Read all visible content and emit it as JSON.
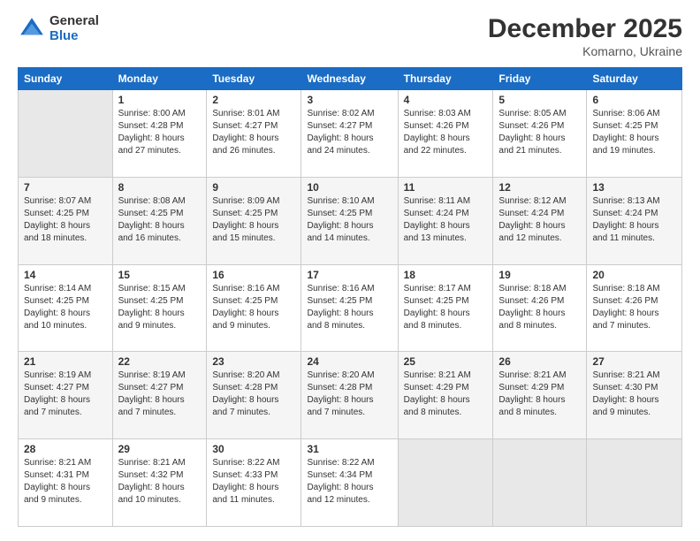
{
  "logo": {
    "general": "General",
    "blue": "Blue"
  },
  "header": {
    "title": "December 2025",
    "location": "Komarno, Ukraine"
  },
  "days_of_week": [
    "Sunday",
    "Monday",
    "Tuesday",
    "Wednesday",
    "Thursday",
    "Friday",
    "Saturday"
  ],
  "weeks": [
    [
      {
        "day": "",
        "info": ""
      },
      {
        "day": "1",
        "info": "Sunrise: 8:00 AM\nSunset: 4:28 PM\nDaylight: 8 hours\nand 27 minutes."
      },
      {
        "day": "2",
        "info": "Sunrise: 8:01 AM\nSunset: 4:27 PM\nDaylight: 8 hours\nand 26 minutes."
      },
      {
        "day": "3",
        "info": "Sunrise: 8:02 AM\nSunset: 4:27 PM\nDaylight: 8 hours\nand 24 minutes."
      },
      {
        "day": "4",
        "info": "Sunrise: 8:03 AM\nSunset: 4:26 PM\nDaylight: 8 hours\nand 22 minutes."
      },
      {
        "day": "5",
        "info": "Sunrise: 8:05 AM\nSunset: 4:26 PM\nDaylight: 8 hours\nand 21 minutes."
      },
      {
        "day": "6",
        "info": "Sunrise: 8:06 AM\nSunset: 4:25 PM\nDaylight: 8 hours\nand 19 minutes."
      }
    ],
    [
      {
        "day": "7",
        "info": "Sunrise: 8:07 AM\nSunset: 4:25 PM\nDaylight: 8 hours\nand 18 minutes."
      },
      {
        "day": "8",
        "info": "Sunrise: 8:08 AM\nSunset: 4:25 PM\nDaylight: 8 hours\nand 16 minutes."
      },
      {
        "day": "9",
        "info": "Sunrise: 8:09 AM\nSunset: 4:25 PM\nDaylight: 8 hours\nand 15 minutes."
      },
      {
        "day": "10",
        "info": "Sunrise: 8:10 AM\nSunset: 4:25 PM\nDaylight: 8 hours\nand 14 minutes."
      },
      {
        "day": "11",
        "info": "Sunrise: 8:11 AM\nSunset: 4:24 PM\nDaylight: 8 hours\nand 13 minutes."
      },
      {
        "day": "12",
        "info": "Sunrise: 8:12 AM\nSunset: 4:24 PM\nDaylight: 8 hours\nand 12 minutes."
      },
      {
        "day": "13",
        "info": "Sunrise: 8:13 AM\nSunset: 4:24 PM\nDaylight: 8 hours\nand 11 minutes."
      }
    ],
    [
      {
        "day": "14",
        "info": "Sunrise: 8:14 AM\nSunset: 4:25 PM\nDaylight: 8 hours\nand 10 minutes."
      },
      {
        "day": "15",
        "info": "Sunrise: 8:15 AM\nSunset: 4:25 PM\nDaylight: 8 hours\nand 9 minutes."
      },
      {
        "day": "16",
        "info": "Sunrise: 8:16 AM\nSunset: 4:25 PM\nDaylight: 8 hours\nand 9 minutes."
      },
      {
        "day": "17",
        "info": "Sunrise: 8:16 AM\nSunset: 4:25 PM\nDaylight: 8 hours\nand 8 minutes."
      },
      {
        "day": "18",
        "info": "Sunrise: 8:17 AM\nSunset: 4:25 PM\nDaylight: 8 hours\nand 8 minutes."
      },
      {
        "day": "19",
        "info": "Sunrise: 8:18 AM\nSunset: 4:26 PM\nDaylight: 8 hours\nand 8 minutes."
      },
      {
        "day": "20",
        "info": "Sunrise: 8:18 AM\nSunset: 4:26 PM\nDaylight: 8 hours\nand 7 minutes."
      }
    ],
    [
      {
        "day": "21",
        "info": "Sunrise: 8:19 AM\nSunset: 4:27 PM\nDaylight: 8 hours\nand 7 minutes."
      },
      {
        "day": "22",
        "info": "Sunrise: 8:19 AM\nSunset: 4:27 PM\nDaylight: 8 hours\nand 7 minutes."
      },
      {
        "day": "23",
        "info": "Sunrise: 8:20 AM\nSunset: 4:28 PM\nDaylight: 8 hours\nand 7 minutes."
      },
      {
        "day": "24",
        "info": "Sunrise: 8:20 AM\nSunset: 4:28 PM\nDaylight: 8 hours\nand 7 minutes."
      },
      {
        "day": "25",
        "info": "Sunrise: 8:21 AM\nSunset: 4:29 PM\nDaylight: 8 hours\nand 8 minutes."
      },
      {
        "day": "26",
        "info": "Sunrise: 8:21 AM\nSunset: 4:29 PM\nDaylight: 8 hours\nand 8 minutes."
      },
      {
        "day": "27",
        "info": "Sunrise: 8:21 AM\nSunset: 4:30 PM\nDaylight: 8 hours\nand 9 minutes."
      }
    ],
    [
      {
        "day": "28",
        "info": "Sunrise: 8:21 AM\nSunset: 4:31 PM\nDaylight: 8 hours\nand 9 minutes."
      },
      {
        "day": "29",
        "info": "Sunrise: 8:21 AM\nSunset: 4:32 PM\nDaylight: 8 hours\nand 10 minutes."
      },
      {
        "day": "30",
        "info": "Sunrise: 8:22 AM\nSunset: 4:33 PM\nDaylight: 8 hours\nand 11 minutes."
      },
      {
        "day": "31",
        "info": "Sunrise: 8:22 AM\nSunset: 4:34 PM\nDaylight: 8 hours\nand 12 minutes."
      },
      {
        "day": "",
        "info": ""
      },
      {
        "day": "",
        "info": ""
      },
      {
        "day": "",
        "info": ""
      }
    ]
  ]
}
